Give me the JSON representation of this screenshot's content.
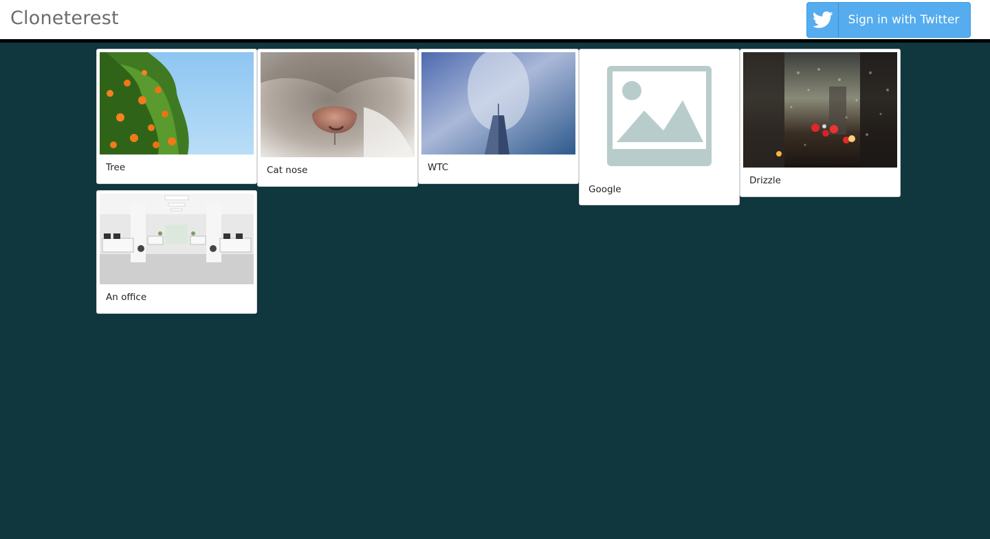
{
  "header": {
    "brand": "Cloneterest",
    "signin_label": "Sign in with Twitter",
    "signin_icon": "twitter-bird-icon",
    "twitter_color": "#55acee"
  },
  "page": {
    "background": "#10363e"
  },
  "pins": [
    {
      "title": "Tree",
      "image": "orange-tree-photo"
    },
    {
      "title": "Cat nose",
      "image": "cat-nose-photo"
    },
    {
      "title": "WTC",
      "image": "wtc-tower-photo"
    },
    {
      "title": "Google",
      "image": "image-placeholder-icon"
    },
    {
      "title": "Drizzle",
      "image": "rainy-window-photo"
    },
    {
      "title": "An office",
      "image": "office-interior-photo"
    }
  ]
}
